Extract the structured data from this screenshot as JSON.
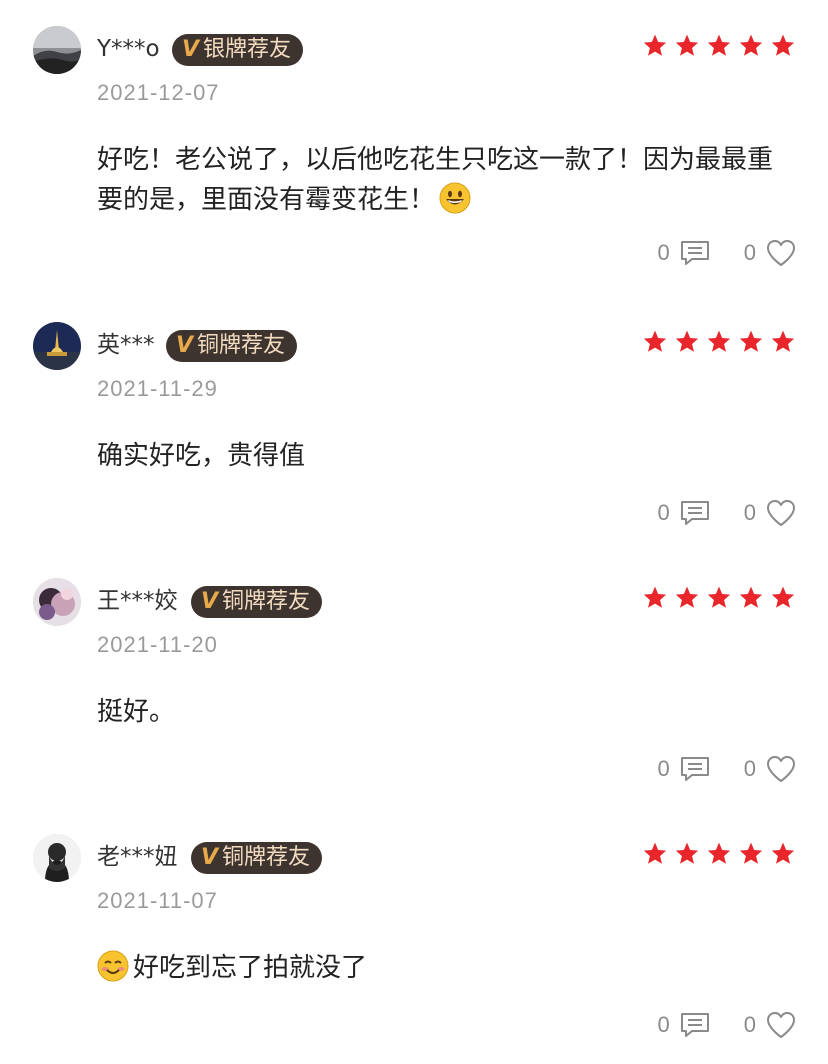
{
  "reviews": [
    {
      "username": "Y***o",
      "badge": "银牌荐友",
      "badge_v": "V",
      "date": "2021-12-07",
      "text": "好吃！老公说了，以后他吃花生只吃这一款了！因为最最重要的是，里面没有霉变花生！",
      "emoji_after": "grinning-face",
      "stars": 5,
      "comments": "0",
      "likes": "0"
    },
    {
      "username": "英***",
      "badge": "铜牌荐友",
      "badge_v": "V",
      "date": "2021-11-29",
      "text": "确实好吃，贵得值",
      "stars": 5,
      "comments": "0",
      "likes": "0"
    },
    {
      "username": "王***姣",
      "badge": "铜牌荐友",
      "badge_v": "V",
      "date": "2021-11-20",
      "text": "挺好。",
      "stars": 5,
      "comments": "0",
      "likes": "0"
    },
    {
      "username": "老***妞",
      "badge": "铜牌荐友",
      "badge_v": "V",
      "date": "2021-11-07",
      "text": "好吃到忘了拍就没了",
      "emoji_before": "blushing-face",
      "stars": 5,
      "comments": "0",
      "likes": "0"
    }
  ],
  "colors": {
    "star": "#e8262c",
    "badge_bg": "#3d3430",
    "badge_text": "#f3dcc0",
    "badge_v": "#e8a94a",
    "date": "#9a9a9a",
    "action": "#8a8a8a"
  },
  "icons": {
    "comment": "comment-icon",
    "like": "heart-icon",
    "star": "star-icon"
  }
}
